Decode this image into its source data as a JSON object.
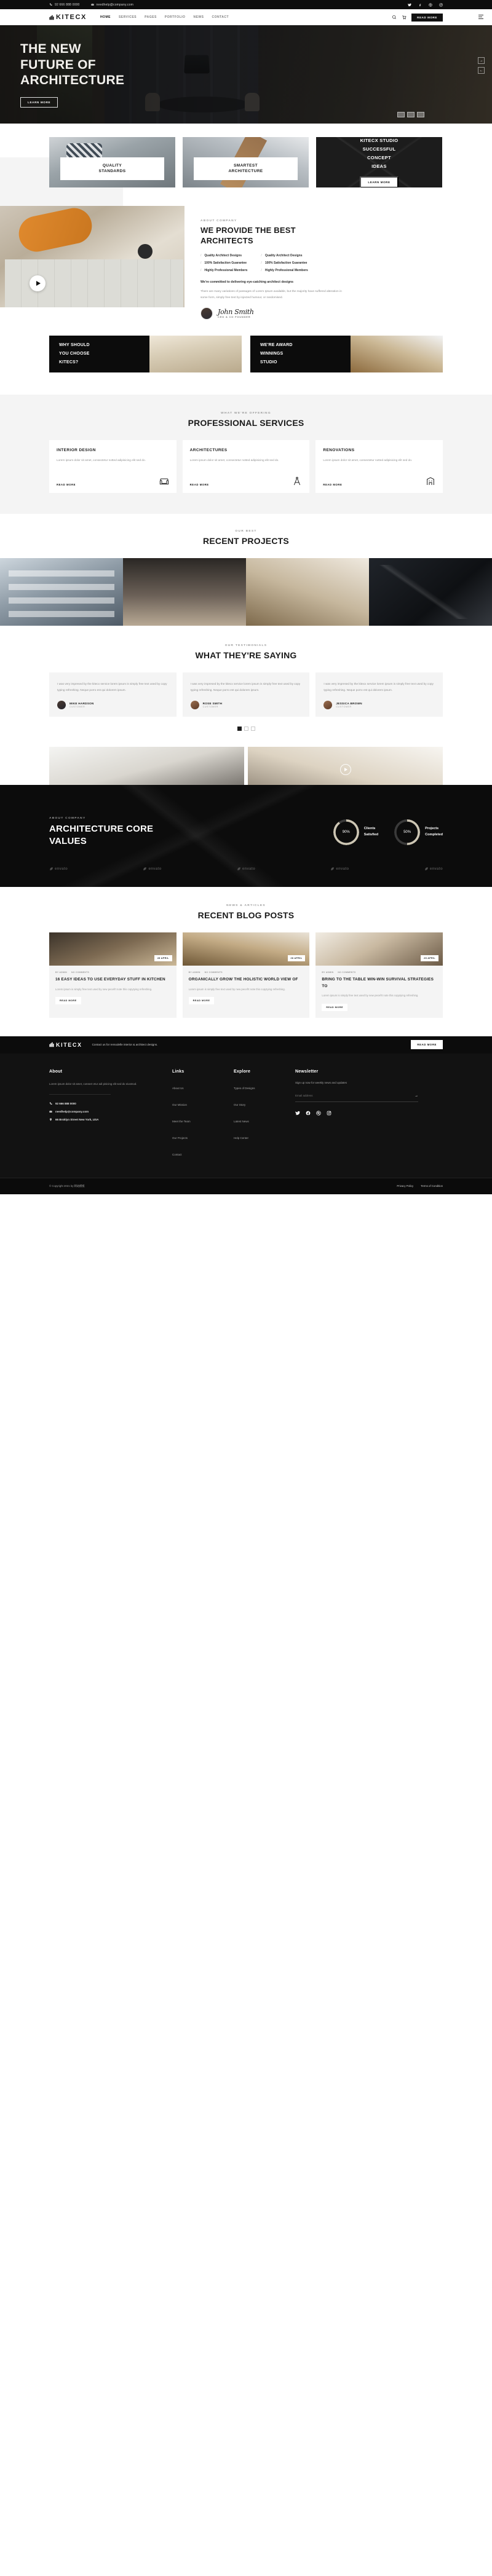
{
  "topbar": {
    "phone": "92 666 888 0000",
    "email": "needhelp@company.com",
    "socials": [
      "twitter-icon",
      "facebook-icon",
      "dribbble-icon",
      "instagram-icon"
    ]
  },
  "header": {
    "brand": "KITECX",
    "nav": [
      "HOME",
      "SERVICES",
      "PAGES",
      "PORTFOLIO",
      "NEWS",
      "CONTACT"
    ],
    "cta": "READ MORE"
  },
  "hero": {
    "title_line1": "THE NEW",
    "title_line2": "FUTURE OF",
    "title_line3": "ARCHITECTURE",
    "button": "LEARN MORE",
    "arrow_next": "→",
    "arrow_prev": "←"
  },
  "features": {
    "cards": [
      {
        "label_line1": "QUALITY",
        "label_line2": "STANDARDS"
      },
      {
        "label_line1": "SMARTEST",
        "label_line2": "ARCHITECTURE"
      }
    ],
    "promo": {
      "line1": "KITECX STUDIO",
      "line2": "SUCCESSFUL",
      "line3": "CONCEPT",
      "line4": "IDEAS",
      "button": "LEARN MORE"
    }
  },
  "about": {
    "eyebrow": "ABOUT COMPANY",
    "title_line1": "WE PROVIDE THE BEST",
    "title_line2": "ARCHITECTS",
    "checks_left": [
      "Quality Architect Designs",
      "100% Satisfaction Guarantee",
      "Highly Professional Members"
    ],
    "checks_right": [
      "Quality Architect Designs",
      "100% Satisfaction Guarantee",
      "Highly Professional Members"
    ],
    "lead": "We're committed to delivering eye-catching architect designs",
    "paragraph": "There are many variations of passages of Lorem Ipsum available, but the majority have suffered alteration in some form, simply free text by injected humour, or randomised.",
    "signature": "John Smith",
    "role": "CEO & CO FOUNDER"
  },
  "banners": [
    {
      "line1": "WHY SHOULD",
      "line2": "YOU CHOOSE",
      "line3": "KITECS?"
    },
    {
      "line1": "WE'RE AWARD",
      "line2": "WINNINGS",
      "line3": "STUDIO"
    }
  ],
  "services": {
    "eyebrow": "WHAT WE'RE OFFERING",
    "title": "PROFESSIONAL SERVICES",
    "items": [
      {
        "title": "INTERIOR DESIGN",
        "text": "Lorem ipsum dolor sit amet, consectetur notted adipisicing elit sed do.",
        "more": "READ MORE",
        "icon": "sofa-icon"
      },
      {
        "title": "ARCHITECTURES",
        "text": "Lorem ipsum dolor sit amet, consectetur notted adipisicing elit sed do.",
        "more": "READ MORE",
        "icon": "compass-icon"
      },
      {
        "title": "RENOVATIONS",
        "text": "Lorem ipsum dolor sit amet, consectetur notted adipisicing elit sed do.",
        "more": "READ MORE",
        "icon": "building-icon"
      }
    ]
  },
  "projects": {
    "eyebrow": "OUR BEST",
    "title": "RECENT PROJECTS"
  },
  "testimonials": {
    "eyebrow": "OUR TESTIMONIALS",
    "title": "WHAT THEY'RE SAYING",
    "quote": "I was very impresed by the kitecx service lorem ipsum is simply free text used by copy typing refreshing. Neque porro est qui dolorem ipsum.",
    "people": [
      {
        "name": "MIKE HARDSON",
        "role": "CUSTOMER"
      },
      {
        "name": "ROSE SMITH",
        "role": "CUSTOMER"
      },
      {
        "name": "JESSICA BROWN",
        "role": "CUSTOMER"
      }
    ]
  },
  "core": {
    "eyebrow": "ABOUT COMPANY",
    "title_line1": "ARCHITECTURE CORE",
    "title_line2": "VALUES",
    "stats": [
      {
        "value": "90%",
        "label_line1": "Clients",
        "label_line2": "Satisfied"
      },
      {
        "value": "50%",
        "label_line1": "Projects",
        "label_line2": "Completed"
      }
    ],
    "brands": [
      "envato",
      "envato",
      "envato",
      "envato",
      "envato"
    ]
  },
  "blog": {
    "eyebrow": "NEWS & ARTICLES",
    "title": "RECENT BLOG POSTS",
    "posts": [
      {
        "badge": "28 APRIL",
        "meta_admin": "BY ADMIN",
        "meta_comments": "NO COMMENTS",
        "title": "16 EASY IDEAS TO USE EVERYDAY STUFF IN KITCHEN",
        "text": "Lorem ipsum is simply free text used by new pecefrt note this copytying refreshing.",
        "more": "READ MORE"
      },
      {
        "badge": "28 APRIL",
        "meta_admin": "BY ADMIN",
        "meta_comments": "NO COMMENTS",
        "title": "ORGANICALLY GROW THE HOLISTIC WORLD VIEW OF",
        "text": "Lorem ipsum is simply free text used by new pecefrt note this copytying refreshing.",
        "more": "READ MORE"
      },
      {
        "badge": "28 APRIL",
        "meta_admin": "BY ADMIN",
        "meta_comments": "NO COMMENTS",
        "title": "BRING TO THE TABLE WIN-WIN SURVIVAL STRATEGIES TO",
        "text": "Lorem ipsum is simply free text used by new pecefrt note this copytying refreshing.",
        "more": "READ MORE"
      }
    ]
  },
  "cta": {
    "brand": "KITECX",
    "text": "Contact us for remodelle interior & architect designs.",
    "button": "READ MORE"
  },
  "footer": {
    "about": {
      "heading": "About",
      "text": "Lorem ipsum dolor sit amet, consect etur adi pisicing elit sed do eiusmod.",
      "phone": "92 666 888 0000",
      "email": "needhelp@company.com",
      "address": "66 Broklyn Street New York, USA"
    },
    "links": {
      "heading": "Links",
      "items": [
        "About Us",
        "Our Mission",
        "Meet the Team",
        "Our Projects",
        "Contact"
      ]
    },
    "explore": {
      "heading": "Explore",
      "items": [
        "Types of Designs",
        "Our Story",
        "Latest News",
        "Help Center"
      ]
    },
    "newsletter": {
      "heading": "Newsletter",
      "text": "Sign up now for weekly news and updates",
      "placeholder": "Email address",
      "submit": "→",
      "socials": [
        "twitter-icon",
        "facebook-icon",
        "dribbble-icon",
        "instagram-icon"
      ]
    },
    "bottom": {
      "copyright": "© Copyright 2021 by 网站模板",
      "links": [
        "Privacy Policy",
        "Terms of Condition"
      ]
    }
  }
}
